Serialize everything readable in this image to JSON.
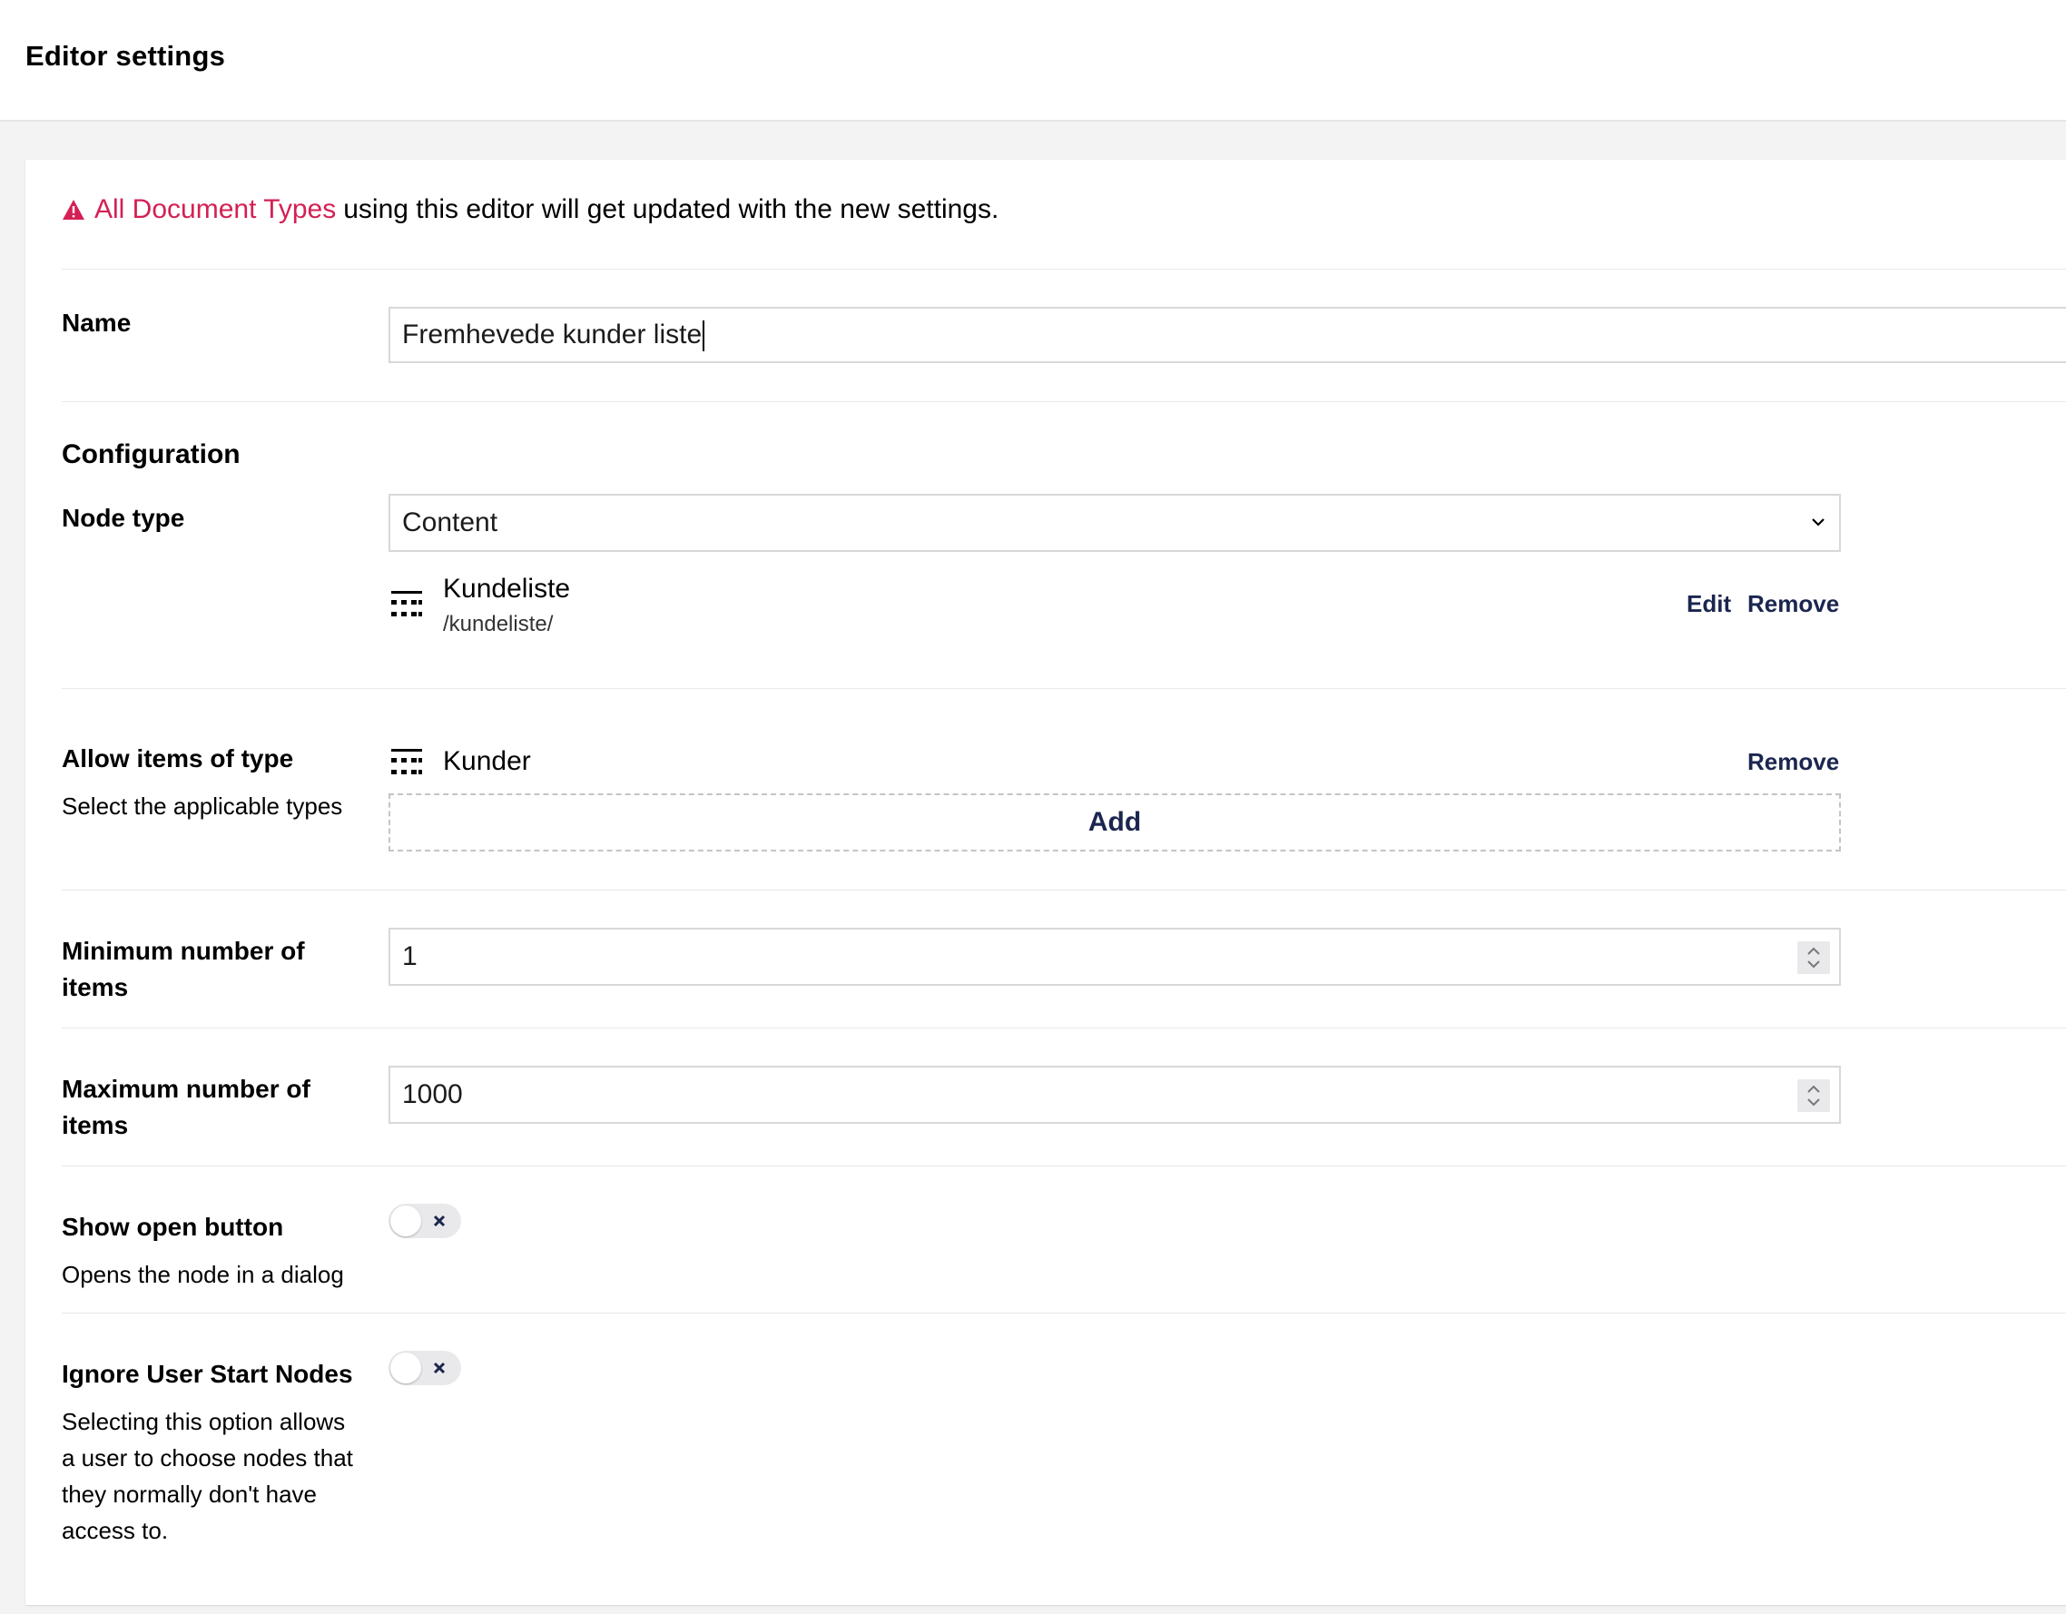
{
  "header": {
    "title": "Editor settings"
  },
  "warning": {
    "icon": "warning-icon",
    "highlight": "All Document Types",
    "text": "using this editor will get updated with the new settings."
  },
  "name_field": {
    "label": "Name",
    "value": "Fremhevede kunder liste"
  },
  "configuration": {
    "title": "Configuration"
  },
  "node_type": {
    "label": "Node type",
    "selected": "Content",
    "start_node": {
      "icon": "list-icon",
      "name": "Kundeliste",
      "path": "/kundeliste/",
      "edit_label": "Edit",
      "remove_label": "Remove"
    }
  },
  "allow_items": {
    "label": "Allow items of type",
    "description": "Select the applicable types",
    "items": [
      {
        "icon": "list-icon",
        "name": "Kunder",
        "remove_label": "Remove"
      }
    ],
    "add_label": "Add"
  },
  "min_items": {
    "label_line1": "Minimum number of",
    "label_line2": "items",
    "value": "1"
  },
  "max_items": {
    "label_line1": "Maximum number of",
    "label_line2": "items",
    "value": "1000"
  },
  "show_open_button": {
    "label": "Show open button",
    "description": "Opens the node in a dialog",
    "enabled": false
  },
  "ignore_start_nodes": {
    "label": "Ignore User Start Nodes",
    "description_lines": [
      "Selecting this option allows",
      "a user to choose nodes that",
      "they normally don't have",
      "access to."
    ],
    "enabled": false
  },
  "colors": {
    "accent": "#d42054",
    "primary": "#1b264f",
    "background": "#f4f3f3",
    "toggle_off": "#e9e9eb"
  }
}
